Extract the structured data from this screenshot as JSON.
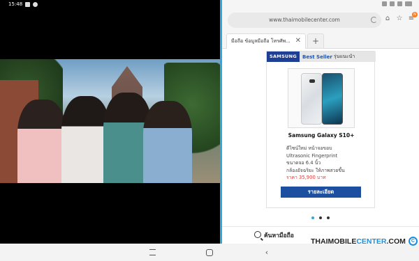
{
  "status_bar": {
    "time": "15:48"
  },
  "video": {
    "description_icon": "video-frame"
  },
  "browser": {
    "url": "www.thaimobilecenter.com",
    "menu_badge": "N",
    "tabs": [
      {
        "label": "มือถือ ข้อมูลมือถือ โทรศัพ...",
        "active": true
      }
    ],
    "new_tab": "+"
  },
  "ad": {
    "brand": "SAMSUNG",
    "bestseller": "Best Seller",
    "recommend": "รุ่นแนะนำ",
    "product_name": "Samsung Galaxy S10+",
    "desc_line1": "ดีไซน์ใหม่ หน้าจอขอบ",
    "desc_line2": "Ultrasonic Fingerprint",
    "desc_line3": "ขนาดจอ 6.4 นิ้ว",
    "desc_line4": "กล้องอัจฉริยะ ให้ภาพสวยขึ้น",
    "price": "ราคา 35,900 บาท",
    "detail_button": "รายละเอียด"
  },
  "carousel": {
    "dot_count": 3,
    "active_index": 0
  },
  "search": {
    "label": "ค้นหามือถือ"
  },
  "watermark": {
    "part1": "THAIMOBILE",
    "part2": "CENTER",
    "part3": ".COM",
    "logo": "C"
  },
  "colors": {
    "divider": "#2fa8dd",
    "samsung_blue": "#1f3f94",
    "button_blue": "#1d4fa0",
    "price_red": "#e53935"
  }
}
